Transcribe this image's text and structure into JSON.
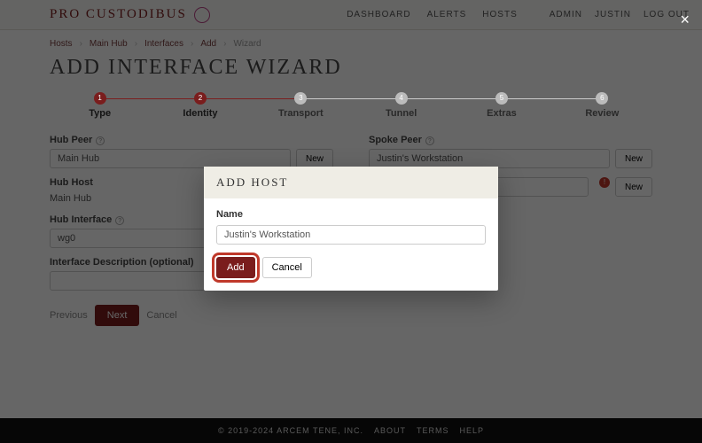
{
  "topbar": {
    "brand": "PRO CUSTODIBUS",
    "nav": [
      "DASHBOARD",
      "ALERTS",
      "HOSTS"
    ],
    "nav_right": [
      "ADMIN",
      "JUSTIN",
      "LOG OUT"
    ]
  },
  "breadcrumbs": [
    {
      "text": "Hosts",
      "link": true
    },
    {
      "text": "Main Hub",
      "link": true
    },
    {
      "text": "Interfaces",
      "link": true
    },
    {
      "text": "Add",
      "link": true
    },
    {
      "text": "Wizard",
      "link": false
    }
  ],
  "page_title": "ADD INTERFACE WIZARD",
  "steps": [
    {
      "num": "1",
      "label": "Type",
      "active": true
    },
    {
      "num": "2",
      "label": "Identity",
      "active": true
    },
    {
      "num": "3",
      "label": "Transport",
      "active": false
    },
    {
      "num": "4",
      "label": "Tunnel",
      "active": false
    },
    {
      "num": "5",
      "label": "Extras",
      "active": false
    },
    {
      "num": "6",
      "label": "Review",
      "active": false
    }
  ],
  "left": {
    "hub_peer_label": "Hub Peer",
    "hub_peer_value": "Main Hub",
    "new_btn": "New",
    "hub_host_label": "Hub Host",
    "hub_host_value": "Main Hub",
    "hub_iface_label": "Hub Interface",
    "hub_iface_value": "wg0",
    "desc_label": "Interface Description (optional)",
    "desc_value": ""
  },
  "right": {
    "spoke_peer_label": "Spoke Peer",
    "spoke_peer_value": "Justin's Workstation",
    "new_btn": "New",
    "spoke_host_value": "",
    "spoke_host_err": "!"
  },
  "buttons": {
    "prev": "Previous",
    "next": "Next",
    "cancel": "Cancel"
  },
  "modal": {
    "title": "ADD HOST",
    "name_label": "Name",
    "name_value": "Justin's Workstation",
    "add": "Add",
    "cancel": "Cancel"
  },
  "footer": {
    "copyright": "© 2019-2024 ARCEM TENE, INC.",
    "links": [
      "ABOUT",
      "TERMS",
      "HELP"
    ]
  }
}
